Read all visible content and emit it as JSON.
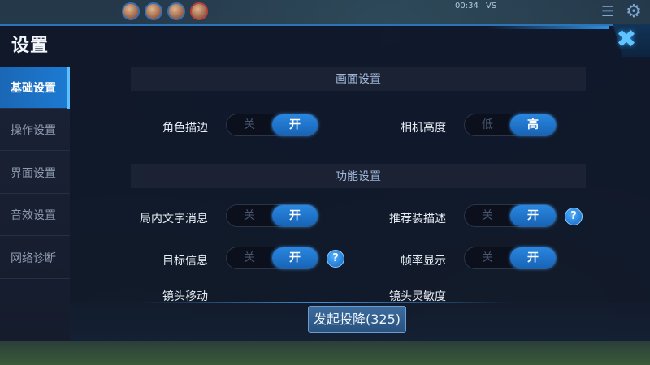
{
  "hud": {
    "timer": "00:34",
    "vs": "VS"
  },
  "modal": {
    "title": "设置",
    "close_icon": "close-icon"
  },
  "sidebar": {
    "items": [
      {
        "label": "基础设置",
        "active": true
      },
      {
        "label": "操作设置",
        "active": false
      },
      {
        "label": "界面设置",
        "active": false
      },
      {
        "label": "音效设置",
        "active": false
      },
      {
        "label": "网络诊断",
        "active": false
      }
    ]
  },
  "sections": {
    "display": "画面设置",
    "function": "功能设置"
  },
  "settings": {
    "role_outline": {
      "label": "角色描边",
      "off": "关",
      "on": "开",
      "value": "开"
    },
    "camera_height": {
      "label": "相机高度",
      "off": "低",
      "on": "高",
      "value": "高"
    },
    "in_game_text": {
      "label": "局内文字消息",
      "off": "关",
      "on": "开",
      "value": "开"
    },
    "recommended_gear": {
      "label": "推荐装描述",
      "off": "关",
      "on": "开",
      "value": "开"
    },
    "target_info": {
      "label": "目标信息",
      "off": "关",
      "on": "开",
      "value": "开"
    },
    "frame_rate": {
      "label": "帧率显示",
      "off": "关",
      "on": "开",
      "value": "开"
    },
    "camera_move": {
      "label": "镜头移动"
    },
    "camera_sensitivity": {
      "label": "镜头灵敏度"
    }
  },
  "help_icon_text": "?",
  "surrender_button": "发起投降(325)",
  "colors": {
    "accent": "#1d7bd3",
    "panel": "#0e1628",
    "toggle_on": "#2a86df"
  }
}
